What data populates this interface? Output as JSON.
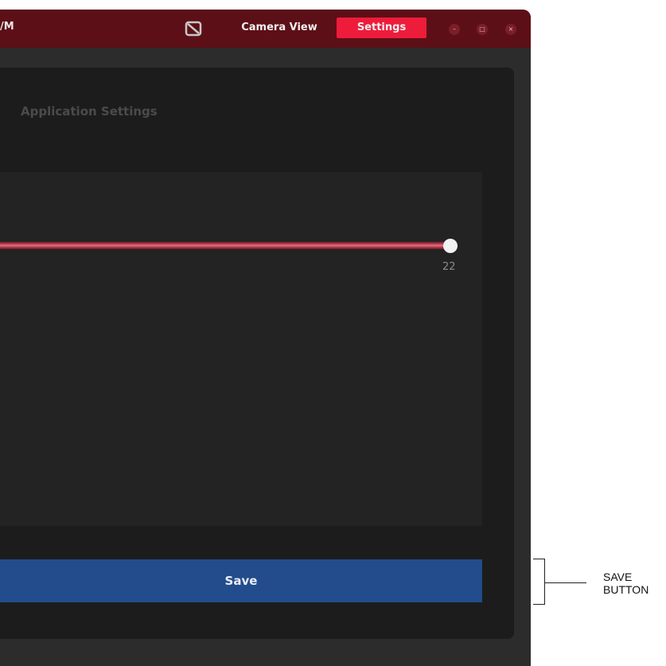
{
  "window": {
    "title_fragment": "/M",
    "app_icon": "camera-app-icon",
    "tabs": [
      {
        "label": "Camera View",
        "active": false
      },
      {
        "label": "Settings",
        "active": true
      }
    ],
    "controls": {
      "minimize": "–",
      "maximize": "□",
      "close": "×"
    }
  },
  "settings_panel": {
    "title": "Application Settings",
    "slider": {
      "value": "22",
      "fill_fraction": 1.0
    }
  },
  "save_button": {
    "label": "Save"
  },
  "annotation": {
    "line1": "SAVE",
    "line2": "BUTTON"
  },
  "colors": {
    "titlebar": "#5d0f17",
    "active_tab": "#ee1c3b",
    "save_button": "#224c8c",
    "slider_fill": "#c24a5d"
  }
}
